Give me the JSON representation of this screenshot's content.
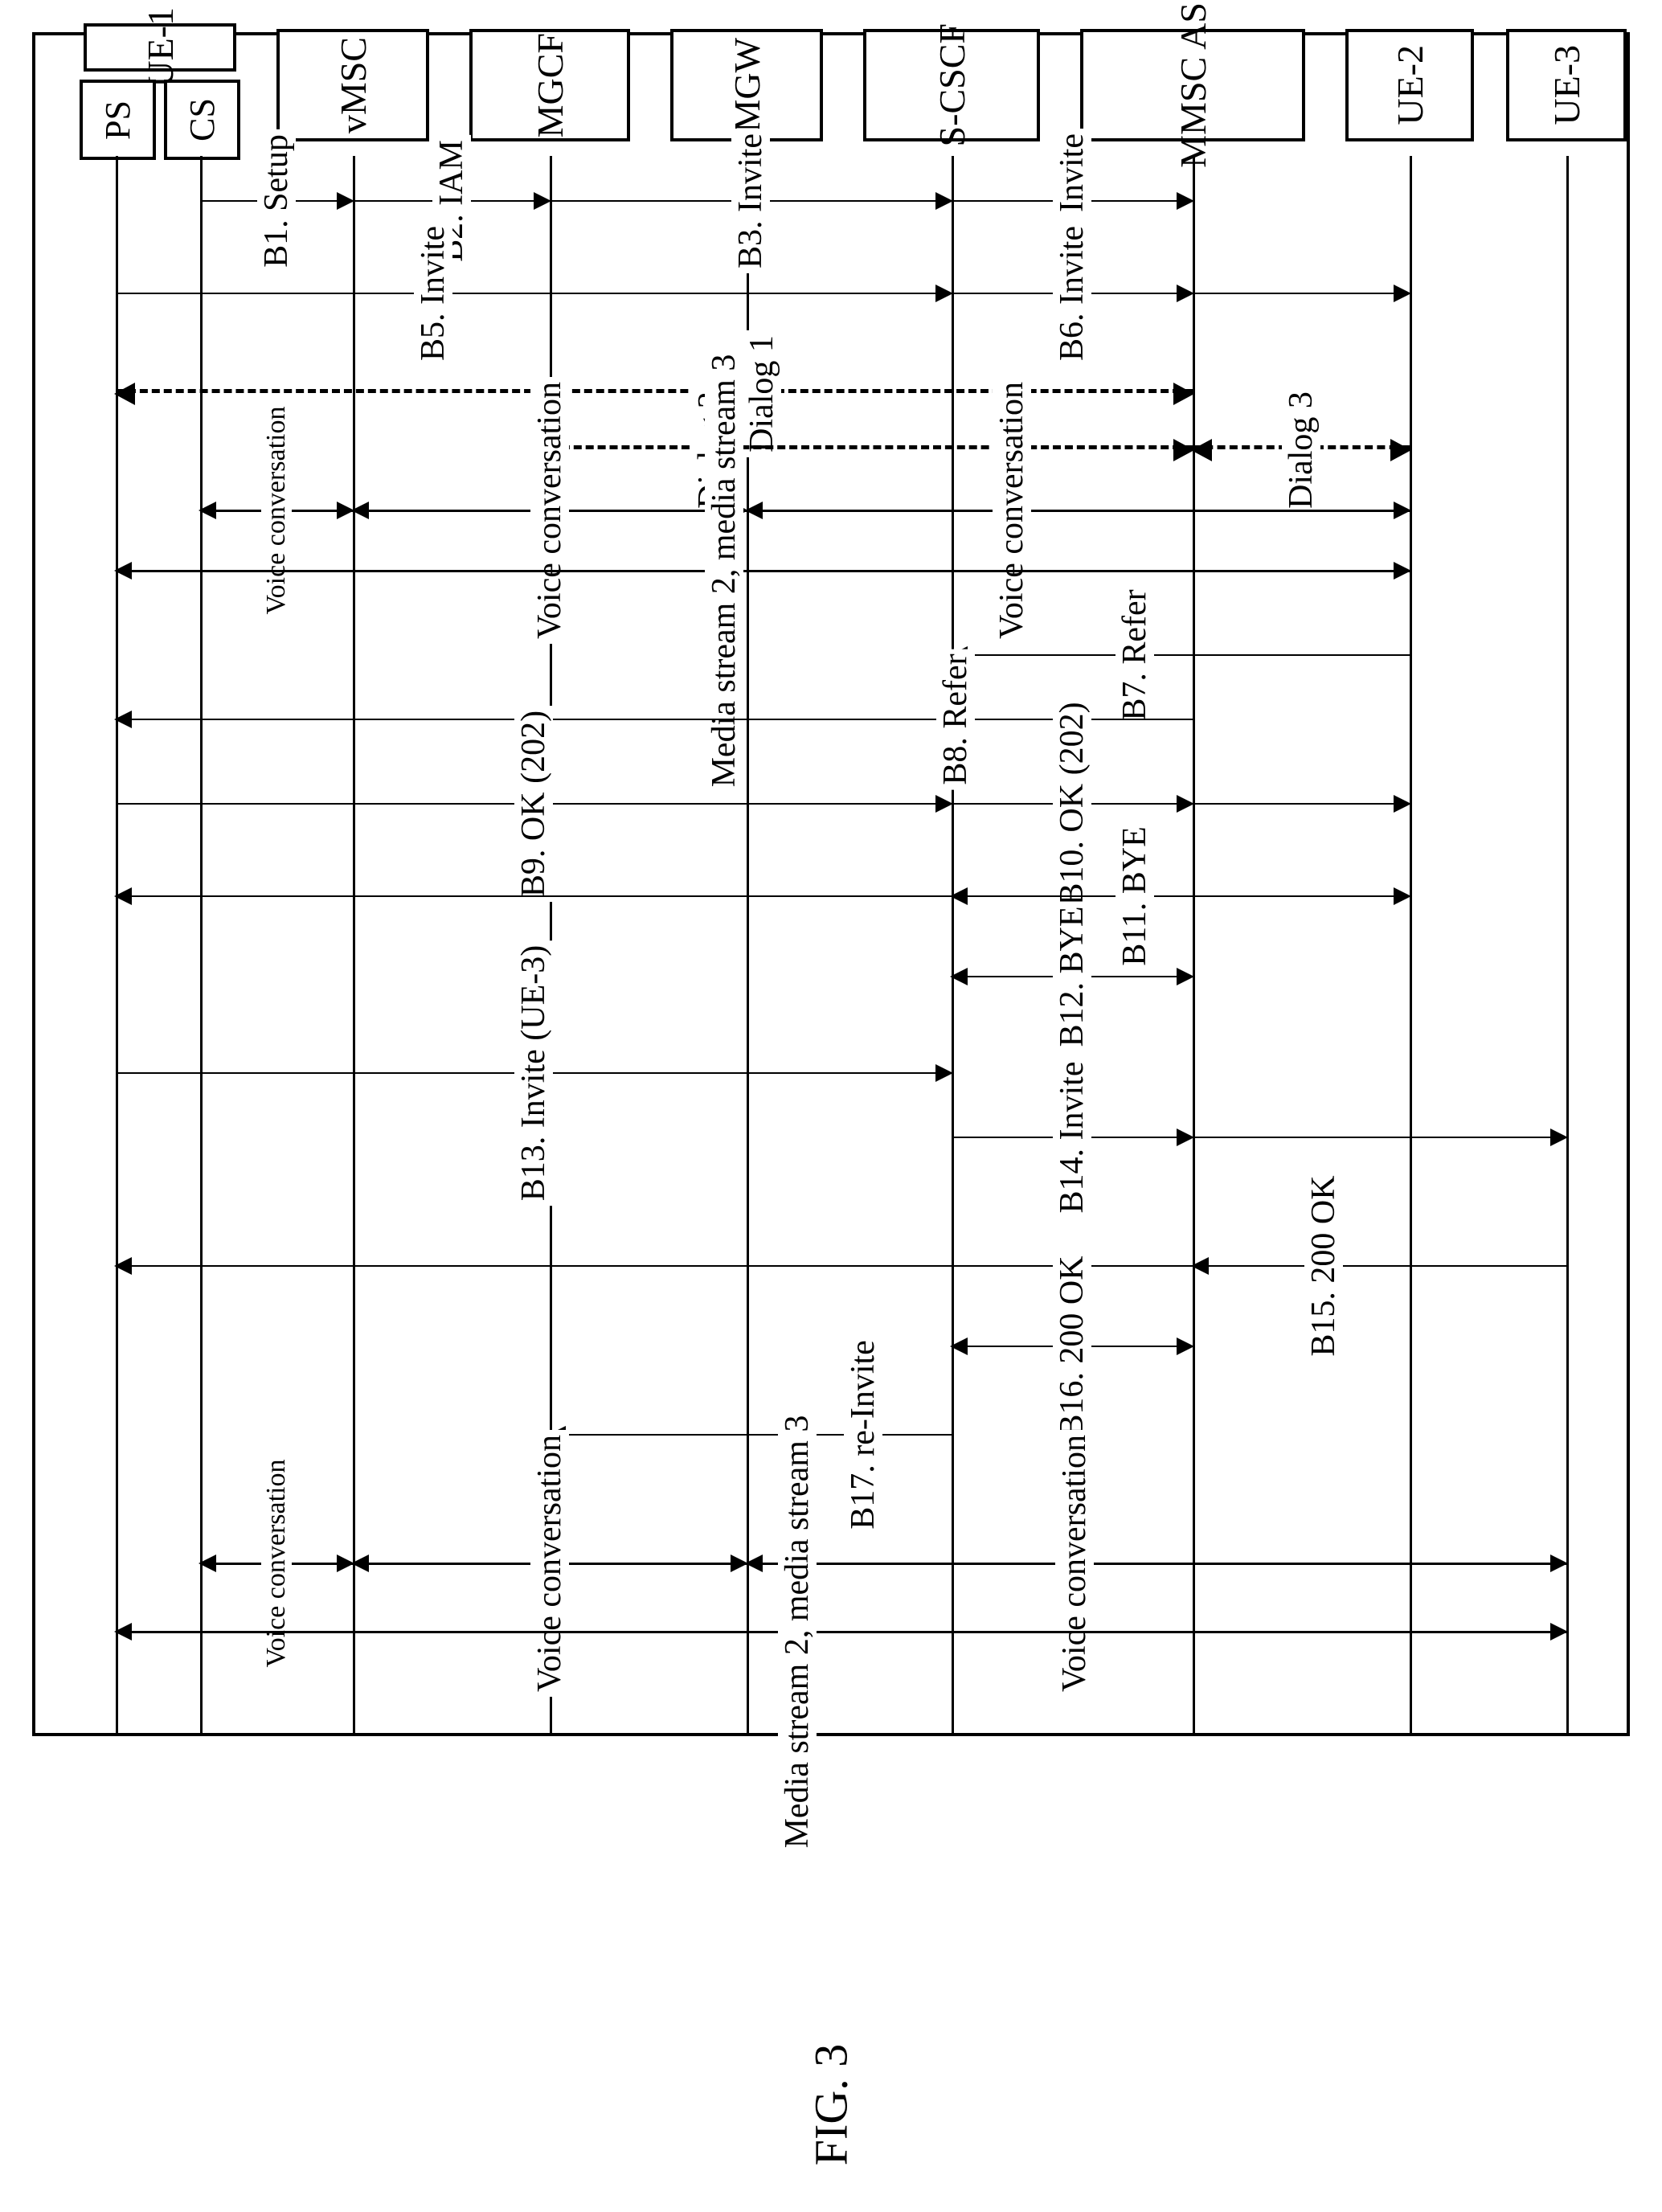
{
  "figure_label": "FIG. 3",
  "participants": {
    "ue1": "UE-1",
    "ue1_ps": "PS",
    "ue1_cs": "CS",
    "vmsc": "vMSC",
    "mgcf": "MGCF",
    "mgw": "MGW",
    "scscf": "S-CSCF",
    "mmsc_as": "MMSC AS",
    "ue2": "UE-2",
    "ue3": "UE-3"
  },
  "messages": {
    "b1": "B1. Setup",
    "b2": "B2. IAM",
    "b3": "B3. Invite",
    "b4": "B4. Invite",
    "b5": "B5. Invite",
    "b6": "B6. Invite",
    "dialog1": "Dialog 1",
    "dialog2": "Dialog 2",
    "dialog3": "Dialog 3",
    "voice_conv_1a": "Voice conversation",
    "voice_conv_1b": "Voice conversation",
    "voice_conv_1c": "Voice conversation",
    "media_23_a": "Media stream 2, media stream 3",
    "b7": "B7. Refer",
    "b8": "B8. Refer",
    "b9": "B9. OK (202)",
    "b10": "B10. OK (202)",
    "b11": "B11. BYE",
    "b12": "B12. BYE",
    "b13": "B13. Invite (UE-3)",
    "b14": "B14. Invite",
    "b15": "B15. 200 OK",
    "b16": "B16. 200 OK",
    "b17": "B17. re-Invite",
    "voice_conv_2a": "Voice conversation",
    "voice_conv_2b": "Voice conversation",
    "voice_conv_2c": "Voice conversation",
    "media_23_b": "Media stream 2, media stream 3"
  },
  "chart_data": {
    "type": "sequence_diagram",
    "title": "FIG. 3",
    "participants": [
      {
        "id": "PS",
        "parent": "UE-1"
      },
      {
        "id": "CS",
        "parent": "UE-1"
      },
      {
        "id": "vMSC"
      },
      {
        "id": "MGCF"
      },
      {
        "id": "MGW"
      },
      {
        "id": "S-CSCF"
      },
      {
        "id": "MMSC AS"
      },
      {
        "id": "UE-2"
      },
      {
        "id": "UE-3"
      }
    ],
    "interactions": [
      {
        "label": "B1. Setup",
        "from": "CS",
        "to": "vMSC",
        "style": "solid"
      },
      {
        "label": "B2. IAM",
        "from": "vMSC",
        "to": "MGCF",
        "style": "solid"
      },
      {
        "label": "B3. Invite",
        "from": "MGCF",
        "to": "S-CSCF",
        "style": "solid"
      },
      {
        "label": "B4. Invite",
        "from": "S-CSCF",
        "to": "MMSC AS",
        "style": "solid"
      },
      {
        "label": "B5. Invite",
        "from": "PS",
        "to": "S-CSCF",
        "style": "solid"
      },
      {
        "label": "B6. Invite",
        "from": "S-CSCF",
        "to": "MMSC AS",
        "style": "solid"
      },
      {
        "label": "Dialog 1",
        "from": "PS",
        "to": "MMSC AS",
        "style": "dashed",
        "direction": "both"
      },
      {
        "label": "Dialog 2",
        "from": "MGCF",
        "to": "MMSC AS",
        "style": "dashed",
        "direction": "both"
      },
      {
        "label": "Dialog 3",
        "from": "MMSC AS",
        "to": "UE-2",
        "style": "dashed",
        "direction": "both"
      },
      {
        "label": "Voice conversation",
        "from": "CS",
        "to": "vMSC",
        "style": "solid",
        "direction": "both"
      },
      {
        "label": "Voice conversation",
        "from": "vMSC",
        "to": "MGW",
        "style": "solid",
        "direction": "both"
      },
      {
        "label": "Voice conversation",
        "from": "MGW",
        "to": "UE-2",
        "style": "solid",
        "direction": "both"
      },
      {
        "label": "Media stream 2, media stream 3",
        "from": "PS",
        "to": "UE-2",
        "style": "solid",
        "direction": "both"
      },
      {
        "label": "B7. Refer",
        "from": "UE-2",
        "to": "MMSC AS",
        "style": "solid"
      },
      {
        "label": "B8. Refer",
        "from": "MMSC AS",
        "to": "S-CSCF",
        "style": "solid"
      },
      {
        "label": "B9. OK (202)",
        "from": "PS",
        "to": "S-CSCF",
        "style": "solid"
      },
      {
        "label": "B10. OK (202)",
        "from": "S-CSCF",
        "to": "MMSC AS",
        "style": "solid"
      },
      {
        "label": "B11. BYE",
        "from": "MMSC AS",
        "to": "UE-2",
        "style": "solid"
      },
      {
        "label": "B12. BYE",
        "from": "MMSC AS",
        "to": "S-CSCF",
        "style": "solid"
      },
      {
        "label": "B13. Invite (UE-3)",
        "from": "PS",
        "to": "S-CSCF",
        "style": "solid"
      },
      {
        "label": "B14. Invite",
        "from": "S-CSCF",
        "to": "MMSC AS",
        "style": "solid"
      },
      {
        "label": "B15. 200 OK",
        "from": "UE-3",
        "to": "MMSC AS",
        "style": "solid"
      },
      {
        "label": "B16. 200 OK",
        "from": "MMSC AS",
        "to": "S-CSCF",
        "style": "solid"
      },
      {
        "label": "B17. re-Invite",
        "from": "S-CSCF",
        "to": "MGCF",
        "style": "solid"
      },
      {
        "label": "Voice conversation",
        "from": "CS",
        "to": "vMSC",
        "style": "solid",
        "direction": "both"
      },
      {
        "label": "Voice conversation",
        "from": "vMSC",
        "to": "MGW",
        "style": "solid",
        "direction": "both"
      },
      {
        "label": "Voice conversation",
        "from": "MGW",
        "to": "UE-3",
        "style": "solid",
        "direction": "both"
      },
      {
        "label": "Media stream 2, media stream 3",
        "from": "PS",
        "to": "UE-3",
        "style": "solid",
        "direction": "both"
      }
    ]
  }
}
